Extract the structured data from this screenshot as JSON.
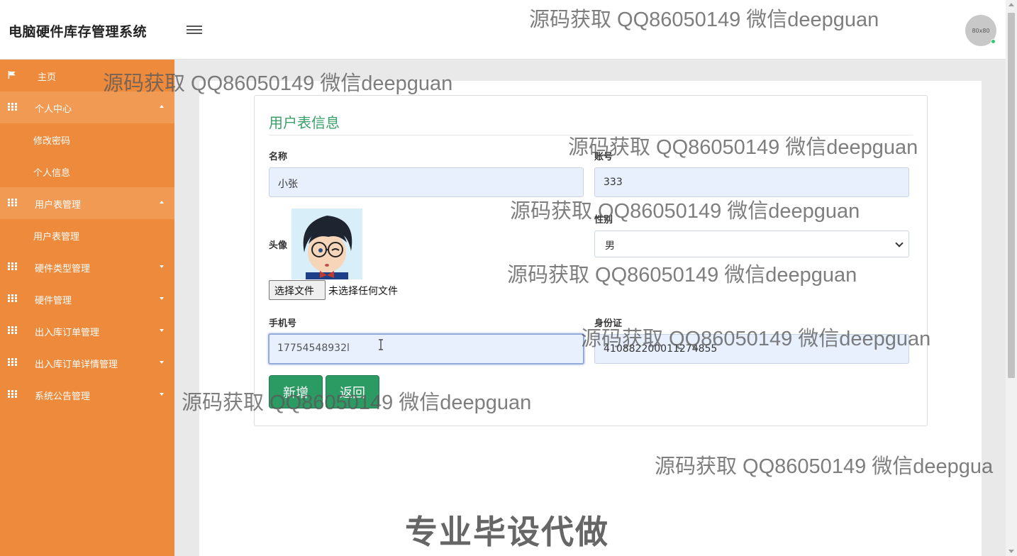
{
  "header": {
    "app_title": "电脑硬件库存管理系统",
    "avatar_text": "80x80"
  },
  "sidebar": {
    "items": [
      {
        "label": "主页",
        "icon": "flag-icon"
      },
      {
        "label": "个人中心",
        "icon": "grid-icon",
        "expanded": true,
        "children": [
          "修改密码",
          "个人信息"
        ]
      },
      {
        "label": "用户表管理",
        "icon": "grid-icon",
        "expanded": true,
        "children": [
          "用户表管理"
        ]
      },
      {
        "label": "硬件类型管理",
        "icon": "grid-icon"
      },
      {
        "label": "硬件管理",
        "icon": "grid-icon"
      },
      {
        "label": "出入库订单管理",
        "icon": "grid-icon"
      },
      {
        "label": "出入库订单详情管理",
        "icon": "grid-icon"
      },
      {
        "label": "系统公告管理",
        "icon": "grid-icon"
      }
    ]
  },
  "form": {
    "title": "用户表信息",
    "name_label": "名称",
    "name_value": "小张",
    "account_label": "账号",
    "account_value": "333",
    "avatar_label": "头像",
    "file_button": "选择文件",
    "file_status": "未选择任何文件",
    "gender_label": "性别",
    "gender_value": "男",
    "phone_label": "手机号",
    "phone_value": "17754548932l",
    "idcard_label": "身份证",
    "idcard_value": "410882200011274855",
    "add_button": "新增",
    "back_button": "返回"
  },
  "watermark": {
    "text": "源码获取 QQ86050149 微信deepguan",
    "text_cut": "源码获取 QQ86050149 微信deepgua",
    "banner": "专业毕设代做"
  }
}
